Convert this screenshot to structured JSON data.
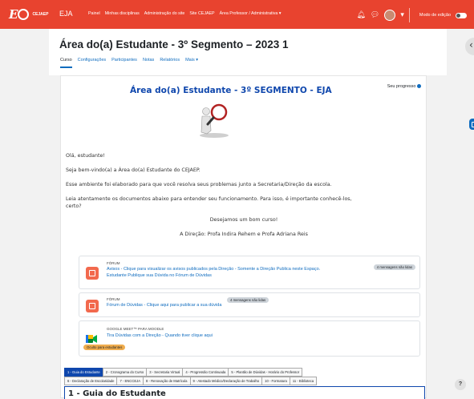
{
  "topbar": {
    "logo_text": "CEJAEP",
    "site_name": "EJA",
    "nav": [
      "Painel",
      "Minhas disciplinas",
      "Administração do site",
      "Site CEJAEP",
      "Área Professor / Administrativa ▾"
    ],
    "edit_mode_label": "Modo de edição",
    "brand_color": "#e8432f"
  },
  "course": {
    "title": "Área do(a) Estudante - 3º Segmento – 2023 1",
    "tabs": [
      "Curso",
      "Configurações",
      "Participantes",
      "Notas",
      "Relatórios",
      "Mais ▾"
    ]
  },
  "section": {
    "title": "Área do(a) Estudante - 3º SEGMENTO - EJA",
    "progress_label": "Seu progresso"
  },
  "intro": {
    "greeting": "Olá, estudante!",
    "welcome": "Seja bem-vindo(a) a Área do(a) Estudante do CEJAEP.",
    "env": "Esse ambiente foi elaborado para que você resolva seus problemas junto a Secretaria/Direção da escola.",
    "read_line1": "Leia atentamente os documentos abaixo para entender seu funcionamento. Para isso, é importante conhecê-los,",
    "read_line2": "certo?",
    "wish": "Desejamos um bom curso!",
    "signature": "A Direção: Profa Indira Rehem e Profa Adriana Reis"
  },
  "activities": [
    {
      "type": "FÓRUM",
      "link_line1": "Avisos - Clique para visualizar os avisos publicados pela Direção - Somente a Direção Publica neste Espaço.",
      "link_line2": "Estudante Publique sua Dúvida no Fórum de Dúvidas",
      "badge": "4 mensagens não lidas"
    },
    {
      "type": "FÓRUM",
      "link_line1": "Fórum de Dúvidas - Clique aqui para publicar a sua dúvida",
      "badge": "4 mensagens não lidas"
    },
    {
      "type": "GOOGLE MEET™ PARA MOODLE",
      "link_line1": "Tira Dúvidas com a Direção - Quando tiver clique aqui",
      "badge": "Oculto para estudantes"
    }
  ],
  "doc_tabs": {
    "row1": [
      "1 - Guia do Estudante",
      "2 - Cronograma do Curso",
      "3 - Secretaria Virtual",
      "4 - Progressão Continuada",
      "5 - Plantão de Dúvidas - Horário do Professor"
    ],
    "row2": [
      "6 - Declaração de Escolaridade",
      "7 - ENCCEJA",
      "8 - Renovação de Matrícula",
      "9 - Atestado Médico/Declaração de Trabalho",
      "10 - Formatura",
      "11 - Biblioteca"
    ]
  },
  "guide_title": "1 - Guia do Estudante",
  "help_label": "?"
}
